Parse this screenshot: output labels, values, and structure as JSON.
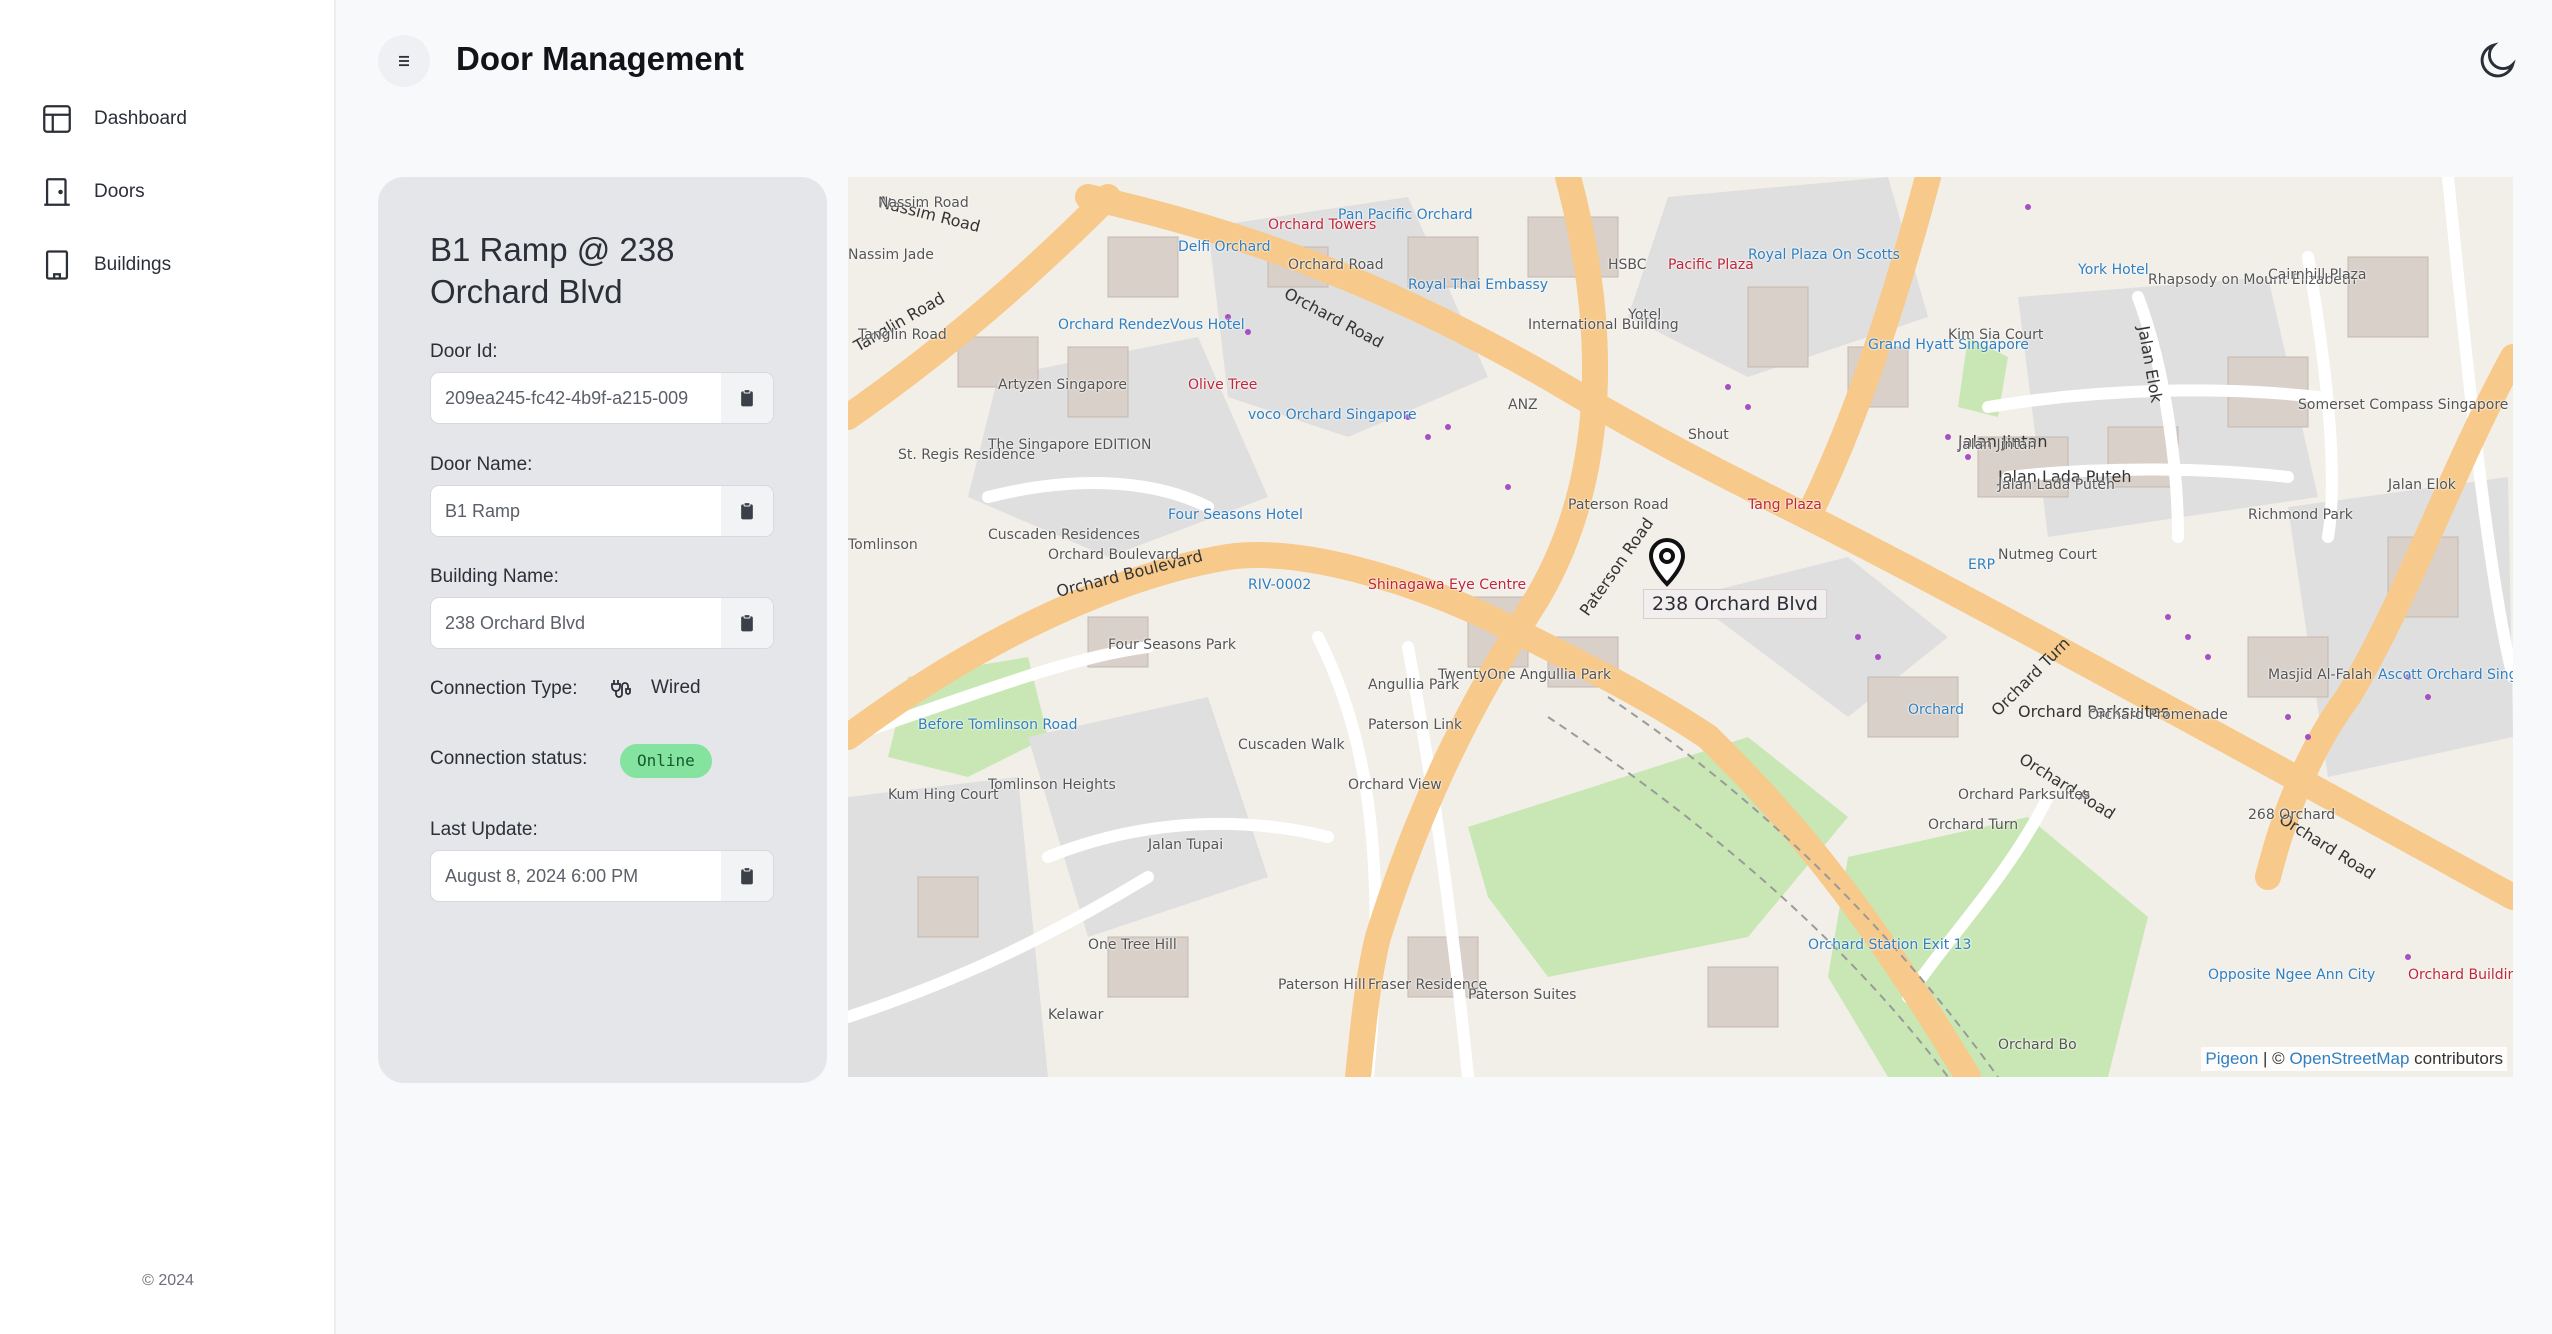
{
  "sidebar": {
    "items": [
      {
        "label": "Dashboard",
        "icon": "layout-icon"
      },
      {
        "label": "Doors",
        "icon": "door-icon"
      },
      {
        "label": "Buildings",
        "icon": "building-icon"
      }
    ],
    "footer": "© 2024"
  },
  "header": {
    "title": "Door Management",
    "menu_icon": "menu-icon",
    "theme_icon": "moon-icon"
  },
  "door": {
    "title": "B1 Ramp @ 238 Orchard Blvd",
    "door_id_label": "Door Id:",
    "door_id_value": "209ea245-fc42-4b9f-a215-009",
    "door_name_label": "Door Name:",
    "door_name_value": "B1 Ramp",
    "building_name_label": "Building Name:",
    "building_name_value": "238 Orchard Blvd",
    "connection_type_label": "Connection Type:",
    "connection_type_value": "Wired",
    "connection_status_label": "Connection status:",
    "connection_status_value": "Online",
    "last_update_label": "Last Update:",
    "last_update_value": "August 8, 2024 6:00 PM"
  },
  "colors": {
    "online_badge": "#83e39f",
    "map_road_major": "#f7c98a",
    "map_park": "#c9e7b4"
  },
  "map": {
    "marker_label": "238 Orchard Blvd",
    "attribution_pigeon": "Pigeon",
    "attribution_sep": " | © ",
    "attribution_osm": "OpenStreetMap",
    "attribution_tail": " contributors",
    "labels": [
      "Nassim Road",
      "Tanglin Road",
      "Orchard Road",
      "Orchard Boulevard",
      "Paterson Road",
      "Delfi Orchard",
      "Orchard Towers",
      "Pan Pacific Orchard",
      "Royal Thai Embassy",
      "HSBC",
      "Pacific Plaza",
      "Royal Plaza On Scotts",
      "Yotel",
      "International Building",
      "ANZ",
      "Olive Tree",
      "voco Orchard Singapore",
      "Orchard RendezVous Hotel",
      "Artyzen Singapore",
      "The Singapore EDITION",
      "St. Regis Residence",
      "Four Seasons Hotel",
      "Cuscaden Residences",
      "RIV-0002",
      "Shinagawa Eye Centre",
      "Shout",
      "Tang Plaza",
      "Grand Hyatt Singapore",
      "Jalan Jintan",
      "Jalan Lada Puteh",
      "Nutmeg Court",
      "Kim Sia Court",
      "York Hotel",
      "Rhapsody on Mount Elizabeth",
      "Cairnhill Plaza",
      "Somerset Compass Singapore",
      "Richmond Park",
      "Jalan Elok",
      "ERP",
      "Masjid Al-Falah",
      "Ascott Orchard Singapore",
      "Orchard Promenade",
      "268 Orchard",
      "Orchard",
      "Orchard Parksuites",
      "Orchard Turn",
      "Orchard Station Exit 13",
      "Opposite Ngee Ann City",
      "Orchard Building",
      "Four Seasons Park",
      "TwentyOne Angullia Park",
      "Cuscaden Walk",
      "Angullia Park",
      "Paterson Link",
      "Tomlinson Heights",
      "Kum Hing Court",
      "Jalan Tupai",
      "One Tree Hill",
      "Kelawar",
      "Fraser Residence",
      "Paterson Suites",
      "Before Tomlinson Road",
      "Orchard View",
      "Paterson Hill",
      "Orchard Bo",
      "Nassim Jade",
      "Tomlinson"
    ]
  }
}
